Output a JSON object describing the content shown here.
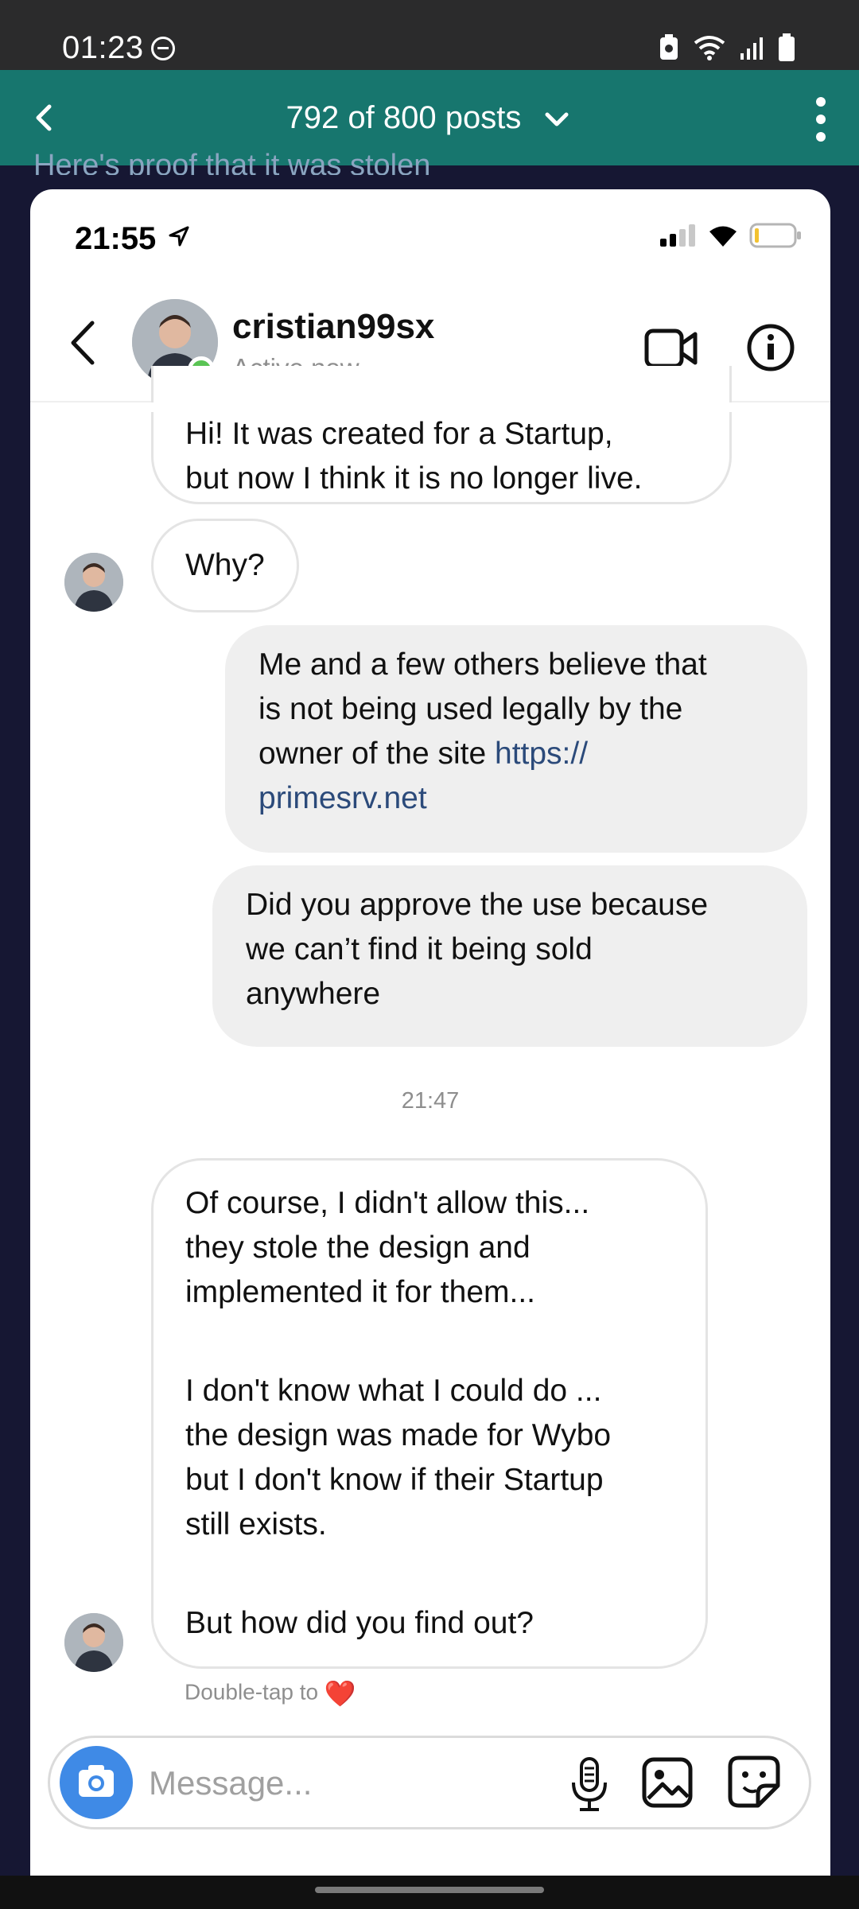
{
  "system_status": {
    "time": "01:23",
    "icons": [
      "do-not-disturb-icon",
      "battery-saver-icon",
      "wifi-icon",
      "signal-icon",
      "battery-icon"
    ]
  },
  "app_bar": {
    "title": "792 of 800 posts",
    "post_title_peek": "Here's proof that it was stolen"
  },
  "screenshot": {
    "ios_time": "21:55",
    "header": {
      "username": "cristian99sx",
      "status": "Active now"
    },
    "messages": [
      {
        "side": "in",
        "text_line1": "Hi! It was created for a Startup,",
        "text_line2": "but now I think it is no longer live."
      },
      {
        "side": "in",
        "text": "Why?"
      },
      {
        "side": "out",
        "text_line1": "Me and a few others believe that",
        "text_line2": "is not being used legally by the",
        "text_line3": "owner of the site ",
        "link_part1": "https://",
        "link_part2": "primesrv.net"
      },
      {
        "side": "out",
        "text_line1": "Did you approve the use because",
        "text_line2": "we can’t find it being sold",
        "text_line3": "anywhere"
      },
      {
        "timestamp": "21:47"
      },
      {
        "side": "in",
        "p1_l1": "Of course, I didn't allow this...",
        "p1_l2": "they stole the design and",
        "p1_l3": "implemented it for them...",
        "p2_l1": "I don't know what I could do ...",
        "p2_l2": "the design was made for Wybo",
        "p2_l3": "but I don't know if their Startup",
        "p2_l4": "still exists.",
        "p3_l1": "But how did you find out?"
      }
    ],
    "double_tap_hint": "Double-tap to",
    "heart": "❤️",
    "composer": {
      "placeholder": "Message..."
    }
  },
  "colors": {
    "app_bar": "#17766e",
    "background": "#161733",
    "link": "#2b4a7a",
    "online": "#5ac454",
    "camera": "#3f8ae6"
  }
}
